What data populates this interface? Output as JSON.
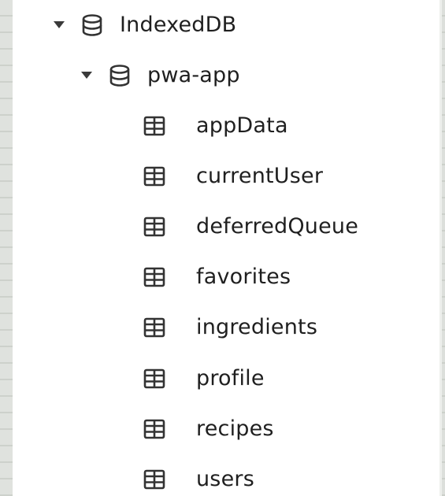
{
  "tree": {
    "root": {
      "label": "IndexedDB",
      "icon": "database-icon",
      "expanded": true
    },
    "database": {
      "label": "pwa-app",
      "icon": "database-icon",
      "expanded": true
    },
    "object_stores": [
      {
        "label": "appData",
        "icon": "table-icon"
      },
      {
        "label": "currentUser",
        "icon": "table-icon"
      },
      {
        "label": "deferredQueue",
        "icon": "table-icon"
      },
      {
        "label": "favorites",
        "icon": "table-icon"
      },
      {
        "label": "ingredients",
        "icon": "table-icon"
      },
      {
        "label": "profile",
        "icon": "table-icon"
      },
      {
        "label": "recipes",
        "icon": "table-icon"
      },
      {
        "label": "users",
        "icon": "table-icon"
      }
    ]
  },
  "colors": {
    "text": "#1f1f1f",
    "icon": "#333333",
    "panel": "#ffffff",
    "backdrop": "#e2e4e1"
  }
}
